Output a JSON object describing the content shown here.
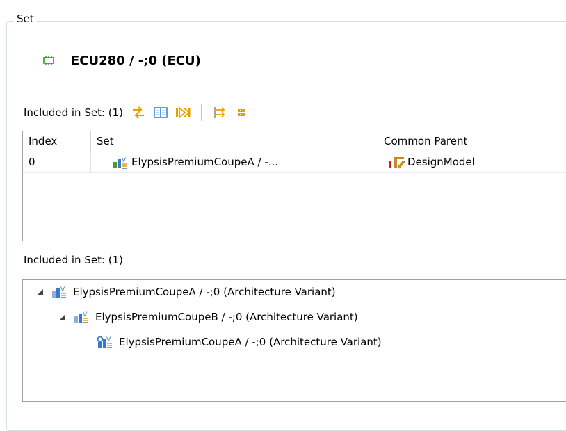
{
  "group": {
    "title": "Set"
  },
  "header": {
    "title": "ECU280 / -;0 (ECU)",
    "icon": "ecu-chip-icon"
  },
  "toolbar": {
    "label": "Included in Set: (1)",
    "buttons": [
      {
        "name": "swap-icon"
      },
      {
        "name": "columns-icon"
      },
      {
        "name": "next-step-icon"
      },
      {
        "name": "filter-arrows-icon"
      },
      {
        "name": "grid-icon"
      }
    ]
  },
  "table": {
    "headers": {
      "index": "Index",
      "set": "Set",
      "parent": "Common Parent"
    },
    "rows": [
      {
        "index": "0",
        "set": "ElypsisPremiumCoupeA / -...",
        "parent": "DesignModel"
      }
    ]
  },
  "tree_label": "Included in Set: (1)",
  "tree": [
    {
      "label": "ElypsisPremiumCoupeA / -;0 (Architecture Variant)",
      "level": 0,
      "expanded": true
    },
    {
      "label": "ElypsisPremiumCoupeB / -;0 (Architecture Variant)",
      "level": 1,
      "expanded": true
    },
    {
      "label": "ElypsisPremiumCoupeA / -;0 (Architecture Variant)",
      "level": 2,
      "expanded": false
    }
  ],
  "colors": {
    "accent": "#e5a000",
    "border": "#a0a0a0",
    "variant_blue": "#3a78c8"
  }
}
